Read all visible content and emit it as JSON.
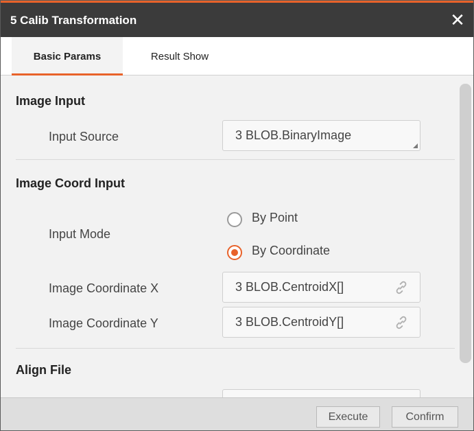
{
  "window": {
    "title": "5 Calib Transformation",
    "close_glyph": "✕"
  },
  "tabs": [
    {
      "label": "Basic Params",
      "active": true
    },
    {
      "label": "Result Show",
      "active": false
    }
  ],
  "sections": {
    "image_input": {
      "title": "Image Input",
      "input_source_label": "Input Source",
      "input_source_value": "3 BLOB.BinaryImage"
    },
    "image_coord_input": {
      "title": "Image Coord Input",
      "input_mode_label": "Input Mode",
      "options": [
        {
          "label": "By Point",
          "checked": false
        },
        {
          "label": "By Coordinate",
          "checked": true
        }
      ],
      "coord_x_label": "Image Coordinate X",
      "coord_x_value": "3 BLOB.CentroidX[]",
      "coord_y_label": "Image Coordinate Y",
      "coord_y_value": "3 BLOB.CentroidY[]"
    },
    "align_file": {
      "title": "Align File"
    }
  },
  "footer": {
    "execute_label": "Execute",
    "confirm_label": "Confirm"
  },
  "colors": {
    "accent": "#e8622a",
    "titlebar": "#3b3b3b",
    "panel": "#f2f2f2"
  },
  "icons": {
    "close": "close-icon",
    "link": "link-icon",
    "resize": "resize-grip-icon"
  }
}
